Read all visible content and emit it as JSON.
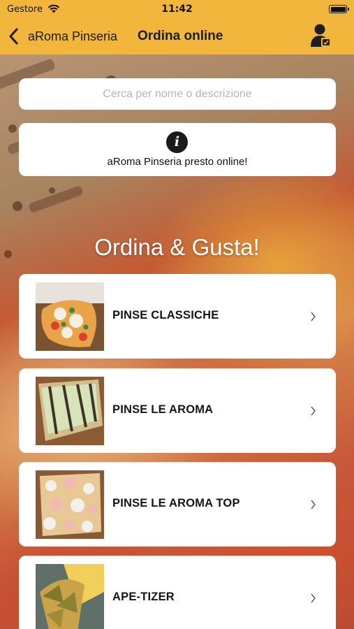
{
  "status_bar": {
    "carrier": "Gestore",
    "time": "11:42"
  },
  "nav": {
    "back_label": "aRoma Pinseria",
    "title": "Ordina online",
    "icons": {
      "back": "chevron-left-icon",
      "account": "user-account-icon"
    }
  },
  "search": {
    "placeholder": "Cerca per nome o descrizione",
    "value": ""
  },
  "info": {
    "icon": "info-icon",
    "message": "aRoma Pinseria presto online!"
  },
  "headline": "Ordina & Gusta!",
  "categories": [
    {
      "label": "PINSE CLASSICHE"
    },
    {
      "label": "PINSE LE AROMA"
    },
    {
      "label": "PINSE LE AROMA TOP"
    },
    {
      "label": "APE-TIZER"
    }
  ],
  "colors": {
    "accent": "#f2b63d",
    "card": "#ffffff",
    "text": "#161616"
  }
}
